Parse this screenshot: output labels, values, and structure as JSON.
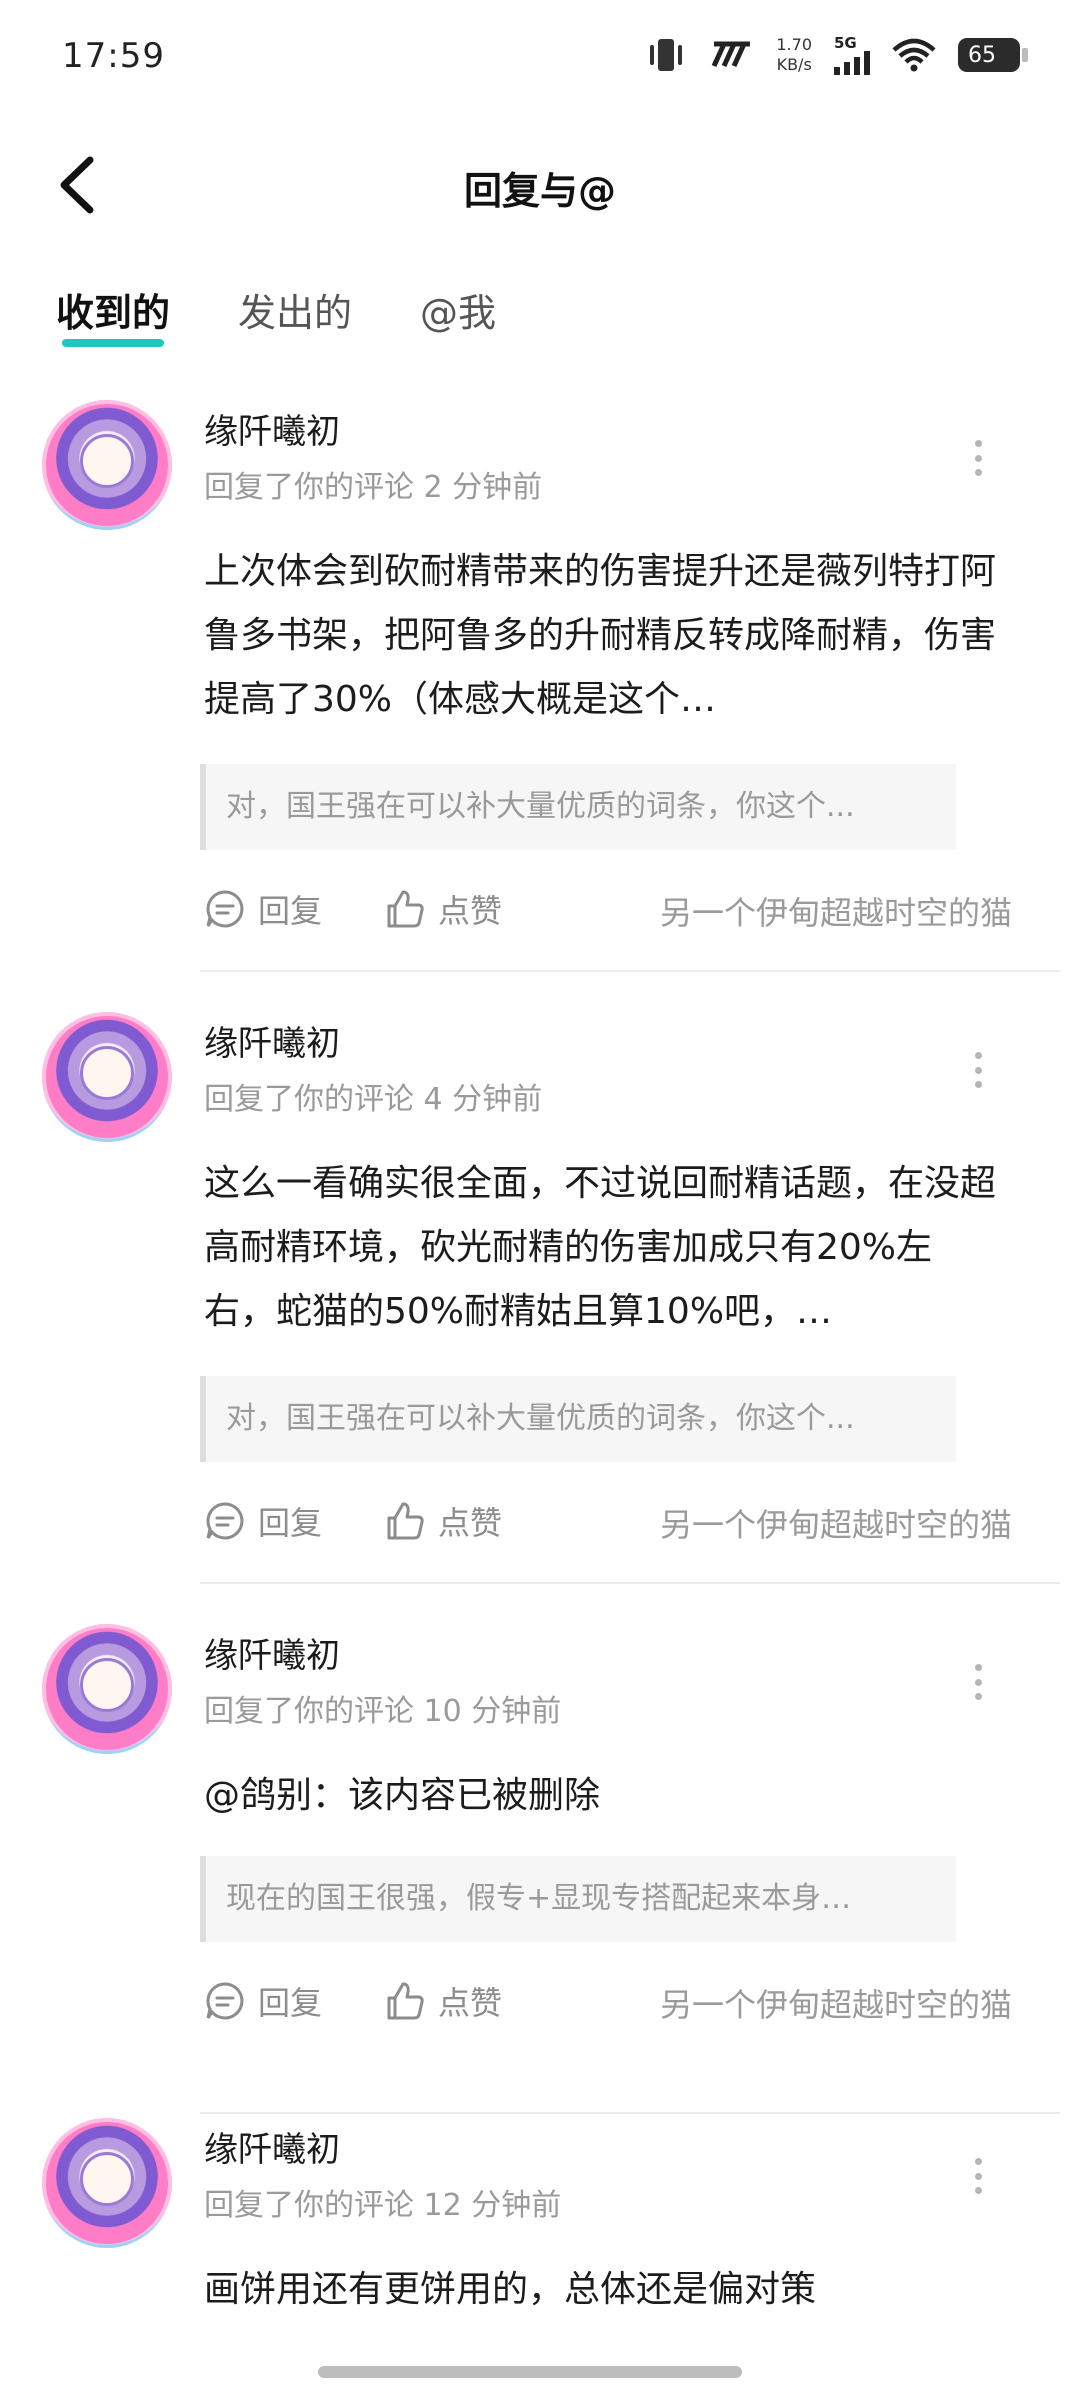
{
  "status_bar": {
    "time": "17:59",
    "net_speed_value": "1.70",
    "net_speed_unit": "KB/s",
    "network": "5G",
    "battery": "65"
  },
  "header": {
    "title": "回复与@"
  },
  "tabs": [
    {
      "label": "收到的",
      "active": true
    },
    {
      "label": "发出的",
      "active": false
    },
    {
      "label": "@我",
      "active": false
    }
  ],
  "items": [
    {
      "name": "缘阡曦初",
      "meta": "回复了你的评论 2 分钟前",
      "content": "上次体会到砍耐精带来的伤害提升还是薇列特打阿鲁多书架，把阿鲁多的升耐精反转成降耐精，伤害提高了30%（体感大概是这个…",
      "quote": "对，国王强在可以补大量优质的词条，你这个...",
      "reply_label": "回复",
      "like_label": "点赞",
      "from": "另一个伊甸超越时空的猫"
    },
    {
      "name": "缘阡曦初",
      "meta": "回复了你的评论 4 分钟前",
      "content": "这么一看确实很全面，不过说回耐精话题，在没超高耐精环境，砍光耐精的伤害加成只有20%左右，蛇猫的50%耐精姑且算10%吧，…",
      "quote": "对，国王强在可以补大量优质的词条，你这个...",
      "reply_label": "回复",
      "like_label": "点赞",
      "from": "另一个伊甸超越时空的猫"
    },
    {
      "name": "缘阡曦初",
      "meta": "回复了你的评论 10 分钟前",
      "content": "@鸽别：该内容已被删除",
      "quote": "现在的国王很强，假专+显现专搭配起来本身…",
      "reply_label": "回复",
      "like_label": "点赞",
      "from": "另一个伊甸超越时空的猫"
    },
    {
      "name": "缘阡曦初",
      "meta": "回复了你的评论 12 分钟前",
      "content": "画饼用还有更饼用的，总体还是偏对策"
    }
  ]
}
